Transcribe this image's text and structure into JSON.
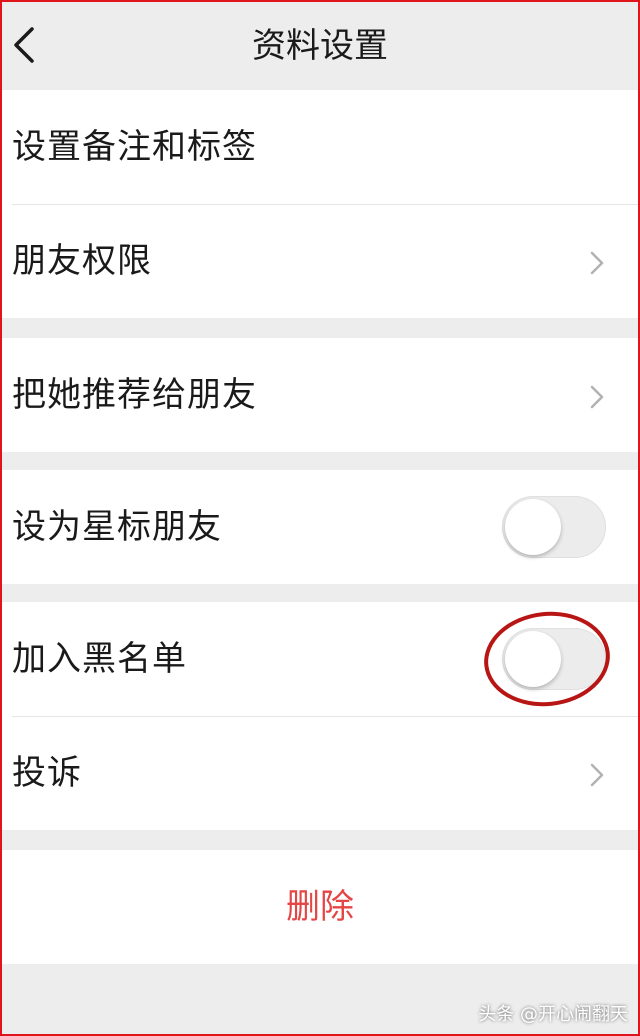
{
  "header": {
    "title": "资料设置",
    "back_icon": "chevron-left-icon"
  },
  "group1": {
    "remarks_label": "设置备注和标签",
    "friend_permissions_label": "朋友权限"
  },
  "group2": {
    "recommend_label": "把她推荐给朋友"
  },
  "group3": {
    "star_friend_label": "设为星标朋友",
    "star_friend_on": false
  },
  "group4": {
    "blacklist_label": "加入黑名单",
    "blacklist_on": false,
    "complaint_label": "投诉"
  },
  "delete": {
    "label": "删除",
    "color": "#e64545"
  },
  "watermark": "头条 @开心闹翻天",
  "colors": {
    "frame": "#e0151b",
    "highlight_ring": "#b81515",
    "background": "#ededed"
  }
}
